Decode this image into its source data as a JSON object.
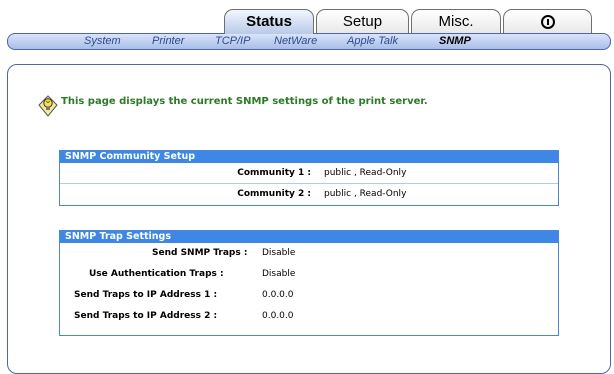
{
  "tabs": [
    {
      "label": "Status",
      "active": true
    },
    {
      "label": "Setup",
      "active": false
    },
    {
      "label": "Misc.",
      "active": false
    },
    {
      "icon": "info-power-icon",
      "active": false
    }
  ],
  "subnav": {
    "items": [
      {
        "label": "System",
        "active": false
      },
      {
        "label": "Printer",
        "active": false
      },
      {
        "label": "TCP/IP",
        "active": false
      },
      {
        "label": "NetWare",
        "active": false
      },
      {
        "label": "Apple Talk",
        "active": false
      },
      {
        "label": "SNMP",
        "active": true
      }
    ]
  },
  "notice": {
    "icon": "hint-lightbulb-icon",
    "text": "This page displays the current SNMP settings of the print server."
  },
  "community": {
    "title": "SNMP Community Setup",
    "rows": [
      {
        "label": "Community 1 :",
        "value": "public , Read-Only"
      },
      {
        "label": "Community 2 :",
        "value": "public , Read-Only"
      }
    ]
  },
  "traps": {
    "title": "SNMP Trap Settings",
    "rows": [
      {
        "label": "Send SNMP Traps :",
        "value": "Disable"
      },
      {
        "label": "Use Authentication Traps :",
        "value": "Disable"
      },
      {
        "label": "Send Traps to IP Address 1 :",
        "value": "0.0.0.0"
      },
      {
        "label": "Send Traps to IP Address 2 :",
        "value": "0.0.0.0"
      }
    ]
  },
  "colors": {
    "accent": "#3f87e5",
    "notice_text": "#2b7a26",
    "subnav_text": "#2d4a8a"
  }
}
